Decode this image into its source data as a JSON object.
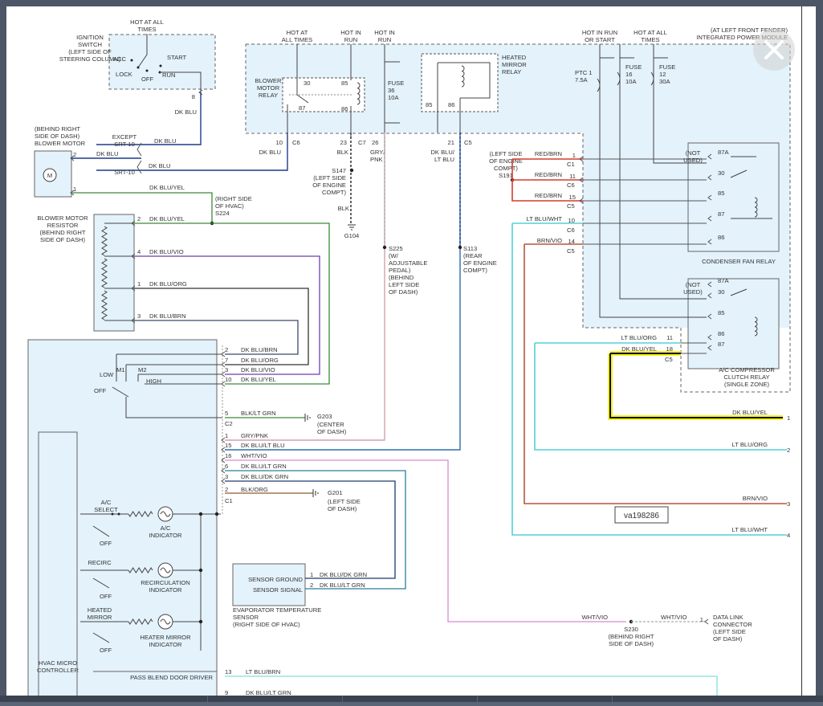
{
  "diagram_id": "va198286",
  "ignition": {
    "hdr": [
      "HOT AT ALL",
      "TIMES"
    ],
    "name": [
      "IGNITION",
      "SWITCH",
      "(LEFT SIDE OF",
      "STEERING COLUMN)"
    ],
    "acc": "ACC",
    "start": "START",
    "lock": "LOCK",
    "off": "OFF",
    "run": "RUN",
    "pin": "8",
    "wire": "DK BLU"
  },
  "ipm": {
    "title": [
      "(AT LEFT FRONT FENDER)",
      "INTEGRATED POWER MODULE"
    ],
    "hot_all_1": [
      "HOT AT",
      "ALL TIMES"
    ],
    "hot_run_1": [
      "HOT IN",
      "RUN"
    ],
    "hot_run_2": [
      "HOT IN",
      "RUN"
    ],
    "hot_run_start": [
      "HOT IN RUN",
      "OR START"
    ],
    "hot_all_2": [
      "HOT AT ALL",
      "TIMES"
    ],
    "blower_relay": [
      "BLOWER",
      "MOTOR",
      "RELAY"
    ],
    "p30": "30",
    "p85": "85",
    "p87": "87",
    "p86": "86",
    "fuse36": [
      "FUSE",
      "36",
      "10A"
    ],
    "mirror_relay": [
      "HEATED",
      "MIRROR",
      "RELAY"
    ],
    "m85": "85",
    "m86": "86",
    "ptc": [
      "PTC 1",
      "7.5A"
    ],
    "fuse16": [
      "FUSE",
      "16",
      "10A"
    ],
    "fuse12": [
      "FUSE",
      "12",
      "30A"
    ]
  },
  "connectors": {
    "p10": "10",
    "c6a": "C6",
    "p23": "23",
    "c7": "C7",
    "p26": "26",
    "p21": "21",
    "c5a": "C5",
    "dkblu": "DK BLU",
    "blk": "BLK",
    "grypnk": [
      "GRY/",
      "PNK"
    ],
    "dkbluLtblu": [
      "DK BLU/",
      "LT BLU"
    ]
  },
  "s147": [
    "S147",
    "(LEFT SIDE",
    "OF ENGINE",
    "COMPT)"
  ],
  "s147_blk": "BLK",
  "g104": "G104",
  "s225": [
    "S225",
    "(W/",
    "ADJUSTABLE",
    "PEDAL)",
    "(BEHIND",
    "LEFT SIDE",
    "OF DASH)"
  ],
  "s113": [
    "S113",
    "(REAR",
    "OF ENGINE",
    "COMPT)"
  ],
  "s191": [
    "(LEFT SIDE",
    "OF ENGINE",
    "COMPT)",
    "S191"
  ],
  "red_wires": [
    {
      "w": "RED/BRN",
      "p": "1",
      "c": "C1"
    },
    {
      "w": "RED/BRN",
      "p": "11",
      "c": "C6"
    },
    {
      "w": "RED/BRN",
      "p": "15",
      "c": "C5"
    }
  ],
  "ltbluwht": {
    "w": "LT BLU/WHT",
    "p": "10",
    "c": "C6"
  },
  "brnvio": {
    "w": "BRN/VIO",
    "p": "14",
    "c": "C5"
  },
  "condenser_relay": {
    "name": "CONDENSER FAN RELAY",
    "notused": [
      "(NOT",
      "USED)"
    ],
    "pins": [
      "87A",
      "30",
      "85",
      "87",
      "86"
    ]
  },
  "ac_relay": {
    "name": [
      "A/C COMPRESSOR",
      "CLUTCH RELAY",
      "(SINGLE ZONE)"
    ],
    "notused": [
      "(NOT",
      "USED)"
    ],
    "pins": [
      "87A",
      "30",
      "85",
      "86",
      "87"
    ],
    "w1": "LT BLU/ORG",
    "p1": "11",
    "w2": "DK BLU/YEL",
    "p2": "18",
    "c": "C5"
  },
  "blower_motor": {
    "loc": [
      "(BEHIND RIGHT",
      "SIDE OF DASH)",
      "BLOWER MOTOR"
    ],
    "except": [
      "EXCEPT",
      "SRT-10"
    ],
    "srt": "SRT-10",
    "p2": "2",
    "p1": "1",
    "dkblu": "DK BLU",
    "dkbluyel": "DK BLU/YEL",
    "m": "M"
  },
  "s224": [
    "(RIGHT SIDE",
    "OF HVAC)",
    "S224"
  ],
  "resistor": {
    "name": [
      "BLOWER MOTOR",
      "RESISTOR",
      "(BEHIND RIGHT",
      "SIDE OF DASH)"
    ],
    "wires": [
      {
        "p": "2",
        "w": "DK BLU/YEL"
      },
      {
        "p": "4",
        "w": "DK BLU/VIO"
      },
      {
        "p": "1",
        "w": "DK BLU/ORG"
      },
      {
        "p": "3",
        "w": "DK BLU/BRN"
      }
    ]
  },
  "hvac": {
    "name": [
      "HVAC MICRO",
      "CONTROLLER"
    ],
    "low": "LOW",
    "m1": "M1",
    "m2": "M2",
    "high": "HIGH",
    "off": "OFF",
    "pins": [
      {
        "p": "2",
        "w": "DK BLU/BRN"
      },
      {
        "p": "7",
        "w": "DK BLU/ORG"
      },
      {
        "p": "3",
        "w": "DK BLU/VIO"
      },
      {
        "p": "10",
        "w": "DK BLU/YEL"
      }
    ],
    "g203": {
      "p": "5",
      "w": "BLK/LT GRN",
      "c": "C2",
      "g": "G203",
      "loc": [
        "(CENTER",
        "OF DASH)"
      ]
    },
    "lower": [
      {
        "p": "1",
        "w": "GRY/PNK"
      },
      {
        "p": "15",
        "w": "DK BLU/LT BLU"
      },
      {
        "p": "16",
        "w": "WHT/VIO"
      },
      {
        "p": "6",
        "w": "DK BLU/LT GRN"
      },
      {
        "p": "3",
        "w": "DK BLU/DK GRN"
      }
    ],
    "g201": {
      "p": "2",
      "w": "BLK/ORG",
      "c": "C1",
      "g": "G201",
      "loc": [
        "(LEFT SIDE",
        "OF DASH)"
      ]
    },
    "ac_select": [
      "A/C",
      "SELECT"
    ],
    "ac_ind": [
      "A/C",
      "INDICATOR"
    ],
    "recirc": "RECIRC",
    "recirc_ind": [
      "RECIRCULATION",
      "INDICATOR"
    ],
    "hmirror": [
      "HEATED",
      "MIRROR"
    ],
    "hmirror_ind": [
      "HEATER MIRROR",
      "INDICATOR"
    ],
    "pass_blend": "PASS BLEND DOOR DRIVER",
    "p13": "13",
    "w13": "LT BLU/BRN",
    "p9": "9",
    "w9": "DK BLU/LT GRN"
  },
  "evap": {
    "gnd": "SENSOR GROUND",
    "sig": "SENSOR SIGNAL",
    "p1": "1",
    "w1": "DK BLU/DK GRN",
    "p2": "2",
    "w2": "DK BLU/LT GRN",
    "name": [
      "EVAPORATOR TEMPERATURE",
      "SENSOR",
      "(RIGHT SIDE OF HVAC)"
    ]
  },
  "s230": {
    "w": "WHT/VIO",
    "w2": "WHT/VIO",
    "name": [
      "S230",
      "(BEHIND RIGHT",
      "SIDE OF DASH)"
    ],
    "dlc_p": "1",
    "dlc": [
      "DATA LINK",
      "CONNECTOR",
      "(LEFT SIDE",
      "OF DASH)"
    ]
  },
  "outputs": [
    {
      "n": "1",
      "w": "DK BLU/YEL"
    },
    {
      "n": "2",
      "w": "LT BLU/ORG"
    },
    {
      "n": "3",
      "w": "BRN/VIO"
    },
    {
      "n": "4",
      "w": "LT BLU/WHT"
    }
  ],
  "colors": {
    "blue_fill": "#e3f2fb",
    "red": "#d63b2a",
    "cyan": "#53d0d6",
    "brown": "#b5573a",
    "pink": "#d88ad8",
    "highlight": "#f5f02a",
    "navy": "#1e3a8a",
    "violet": "#6a3fb5",
    "teal": "#2a7f9a"
  },
  "icons": {
    "close": "close-icon"
  }
}
